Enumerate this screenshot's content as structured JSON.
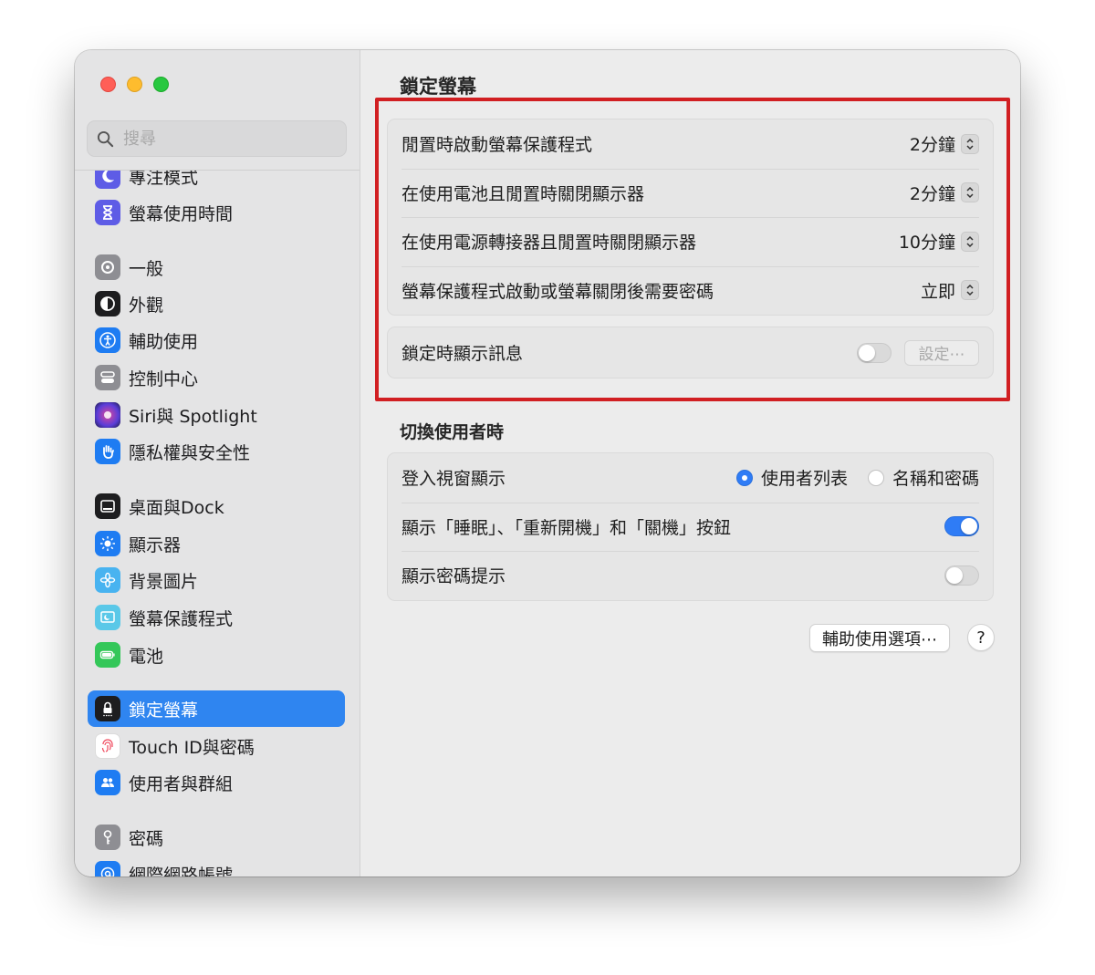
{
  "sidebar": {
    "search_placeholder": "搜尋",
    "items": [
      {
        "label": "專注模式"
      },
      {
        "label": "螢幕使用時間"
      },
      {
        "label": "一般"
      },
      {
        "label": "外觀"
      },
      {
        "label": "輔助使用"
      },
      {
        "label": "控制中心"
      },
      {
        "label": "Siri與 Spotlight"
      },
      {
        "label": "隱私權與安全性"
      },
      {
        "label": "桌面與Dock"
      },
      {
        "label": "顯示器"
      },
      {
        "label": "背景圖片"
      },
      {
        "label": "螢幕保護程式"
      },
      {
        "label": "電池"
      },
      {
        "label": "鎖定螢幕"
      },
      {
        "label": "Touch ID與密碼"
      },
      {
        "label": "使用者與群組"
      },
      {
        "label": "密碼"
      },
      {
        "label": "網際網路帳號"
      }
    ]
  },
  "main": {
    "title": "鎖定螢幕",
    "settings": [
      {
        "label": "閒置時啟動螢幕保護程式",
        "value": "2分鐘"
      },
      {
        "label": "在使用電池且閒置時關閉顯示器",
        "value": "2分鐘"
      },
      {
        "label": "在使用電源轉接器且閒置時關閉顯示器",
        "value": "10分鐘"
      },
      {
        "label": "螢幕保護程式啟動或螢幕關閉後需要密碼",
        "value": "立即"
      }
    ],
    "message": {
      "label": "鎖定時顯示訊息",
      "enabled": false,
      "button": "設定⋯"
    },
    "switch_user": {
      "title": "切換使用者時",
      "login_window": {
        "label": "登入視窗顯示",
        "options": [
          "使用者列表",
          "名稱和密碼"
        ],
        "selected": "使用者列表"
      },
      "show_buttons": {
        "label": "顯示「睡眠」、「重新開機」和「關機」按鈕",
        "enabled": true
      },
      "show_hint": {
        "label": "顯示密碼提示",
        "enabled": false
      }
    },
    "accessibility_button": "輔助使用選項⋯",
    "help_button": "?"
  },
  "colors": {
    "accent": "#2f7cf6",
    "highlight_border": "#d11f22",
    "selected_sidebar": "#2f85f0"
  }
}
